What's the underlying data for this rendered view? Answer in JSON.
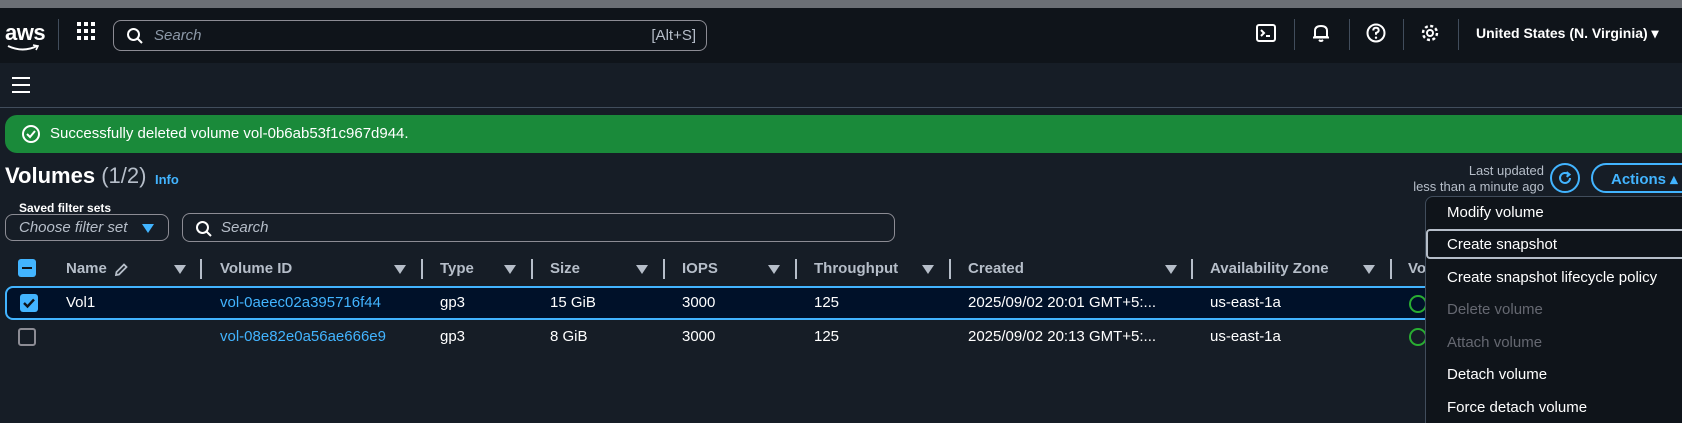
{
  "topbar": {
    "logo_text": "aws",
    "search_placeholder": "Search",
    "search_shortcut": "[Alt+S]",
    "region": "United States (N. Virginia) ▾"
  },
  "flash": {
    "message": "Successfully deleted volume vol-0b6ab53f1c967d944."
  },
  "header": {
    "title": "Volumes",
    "count": "(1/2)",
    "info": "Info",
    "last_updated_label": "Last updated",
    "last_updated_value": "less than a minute ago",
    "actions_label": "Actions ▴"
  },
  "filters": {
    "saved_label": "Saved filter sets",
    "saved_placeholder": "Choose filter set",
    "search_placeholder": "Search"
  },
  "table": {
    "columns": [
      "Name",
      "Volume ID",
      "Type",
      "Size",
      "IOPS",
      "Throughput",
      "Created",
      "Availability Zone",
      "Vo"
    ],
    "rows": [
      {
        "selected": true,
        "name": "Vol1",
        "volume_id": "vol-0aeec02a395716f44",
        "type": "gp3",
        "size": "15 GiB",
        "iops": "3000",
        "throughput": "125",
        "created": "2025/09/02 20:01 GMT+5:...",
        "az": "us-east-1a"
      },
      {
        "selected": false,
        "name": "",
        "volume_id": "vol-08e82e0a56ae666e9",
        "type": "gp3",
        "size": "8 GiB",
        "iops": "3000",
        "throughput": "125",
        "created": "2025/09/02 20:13 GMT+5:...",
        "az": "us-east-1a"
      }
    ]
  },
  "actions_menu": {
    "items": [
      {
        "label": "Modify volume",
        "enabled": true
      },
      {
        "label": "Create snapshot",
        "enabled": true,
        "highlighted": true
      },
      {
        "label": "Create snapshot lifecycle policy",
        "enabled": true
      },
      {
        "label": "Delete volume",
        "enabled": false
      },
      {
        "label": "Attach volume",
        "enabled": false
      },
      {
        "label": "Detach volume",
        "enabled": true
      },
      {
        "label": "Force detach volume",
        "enabled": true
      }
    ]
  },
  "colors": {
    "accent": "#42b4ff",
    "success": "#1a8a3a",
    "background": "#161d26",
    "topbar": "#0f141a"
  }
}
